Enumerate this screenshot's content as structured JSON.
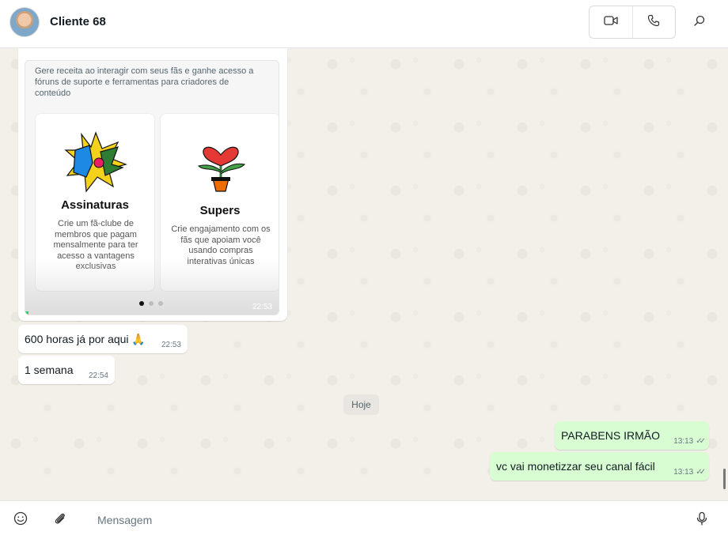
{
  "header": {
    "contact_name": "Cliente 68"
  },
  "card": {
    "intro_text": "Gere receita ao interagir com seus fãs e ganhe acesso a fóruns de suporte e ferramentas para criadores de conteúdo",
    "tiles": [
      {
        "title": "Assinaturas",
        "description": "Crie um fã-clube de membros que pagam mensalmente para ter acesso a vantagens exclusivas"
      },
      {
        "title": "Supers",
        "description": "Crie engajamento com os fãs que apoiam você usando compras interativas únicas"
      }
    ],
    "time": "22:53"
  },
  "messages": [
    {
      "text": "600 horas já por aqui 🙏",
      "time": "22:53",
      "direction": "in"
    },
    {
      "text": "1 semana",
      "time": "22:54",
      "direction": "in"
    },
    {
      "text": "PARABENS IRMÃO",
      "time": "13:13",
      "direction": "out"
    },
    {
      "text": "vc vai monetizzar seu canal fácil",
      "time": "13:13",
      "direction": "out"
    }
  ],
  "day_divider": "Hoje",
  "composer": {
    "placeholder": "Mensagem"
  },
  "colors": {
    "outgoing_bubble": "#d9fdd3",
    "incoming_bubble": "#ffffff",
    "chat_background": "#efeae2",
    "progress_accent": "#25d366"
  }
}
